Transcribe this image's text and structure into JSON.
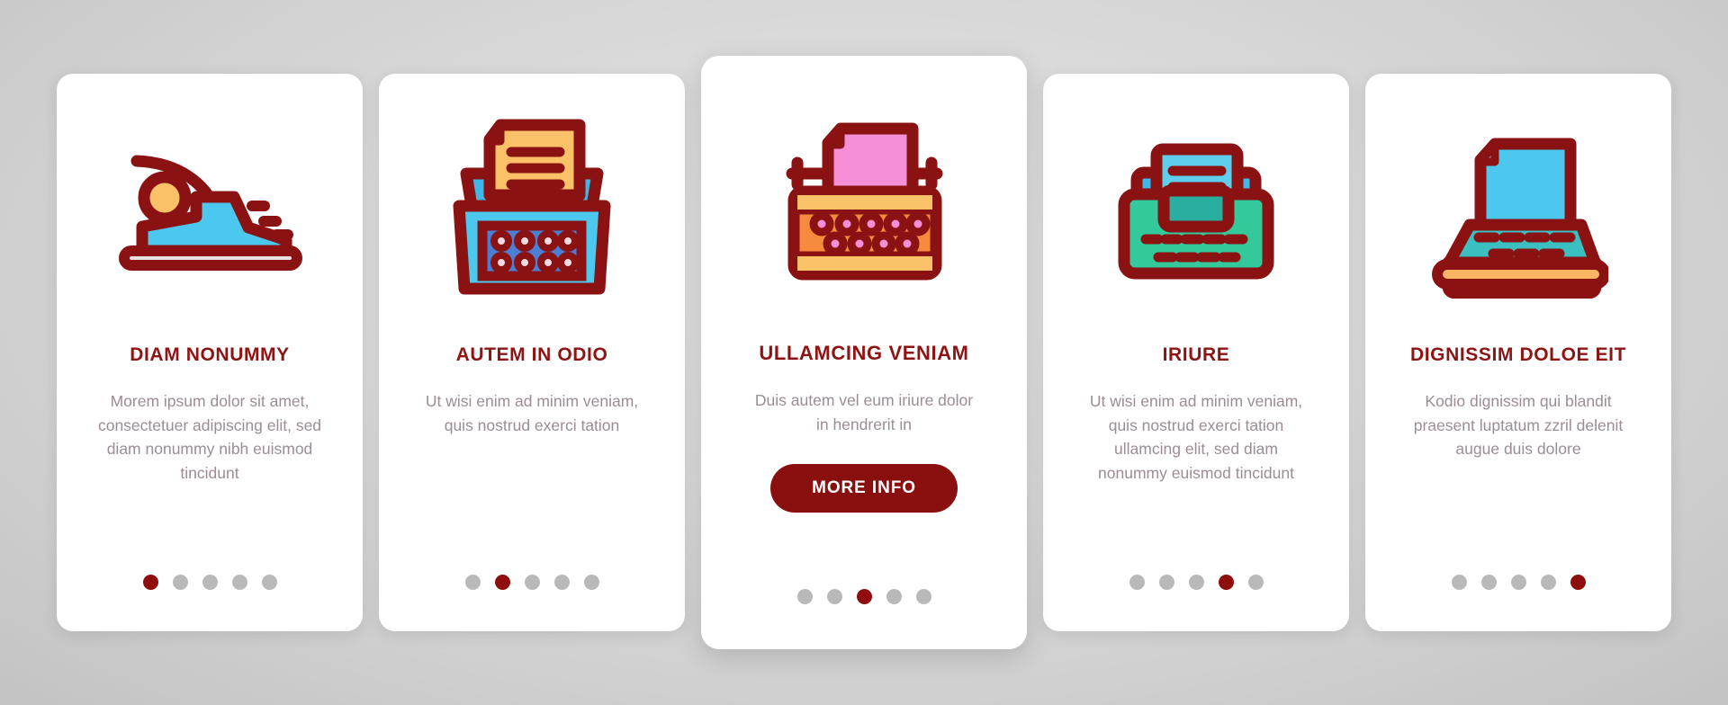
{
  "colors": {
    "accent_dark_red": "#8e1414",
    "button_bg": "#8a0f0f",
    "body_text": "#9c8c96",
    "dot_inactive": "#b9b9b9",
    "dot_active": "#8e0d0d",
    "card_bg": "#ffffff",
    "page_bg": "#d2d2d2",
    "icon_outline": "#8a1212",
    "cyan": "#4cc8ee",
    "yellow": "#f9c268",
    "blue_panel": "#4a7fd4",
    "pink": "#f78fd8",
    "orange": "#f58b3c",
    "orange_light": "#f9a95b",
    "green": "#34c99a",
    "teal": "#3bbfc0",
    "sky": "#3fb8e8"
  },
  "cards": [
    {
      "id": "card-1",
      "icon_name": "typewriter-carriage-icon",
      "title": "DIAM NONUMMY",
      "body": "Morem ipsum dolor sit amet, consectetuer adipiscing elit, sed diam nonummy nibh euismod tincidunt",
      "featured": false,
      "button_label": null,
      "dots": {
        "count": 5,
        "active_index": 0
      }
    },
    {
      "id": "card-2",
      "icon_name": "typewriter-paper-keys-icon",
      "title": "AUTEM IN ODIO",
      "body": "Ut wisi enim ad minim veniam, quis nostrud exerci tation",
      "featured": false,
      "button_label": null,
      "dots": {
        "count": 5,
        "active_index": 1
      }
    },
    {
      "id": "card-3",
      "icon_name": "typewriter-classic-icon",
      "title": "ULLAMCING VENIAM",
      "body": "Duis autem vel eum iriure dolor in hendrerit in",
      "featured": true,
      "button_label": "MORE INFO",
      "dots": {
        "count": 5,
        "active_index": 2
      }
    },
    {
      "id": "card-4",
      "icon_name": "typewriter-green-icon",
      "title": "IRIURE",
      "body": "Ut wisi enim ad minim veniam, quis nostrud exerci tation ullamcing elit, sed diam nonummy euismod tincidunt",
      "featured": false,
      "button_label": null,
      "dots": {
        "count": 5,
        "active_index": 3
      }
    },
    {
      "id": "card-5",
      "icon_name": "typewriter-desk-icon",
      "title": "DIGNISSIM DOLOE EIT",
      "body": "Kodio dignissim qui blandit praesent luptatum zzril delenit augue duis dolore",
      "featured": false,
      "button_label": null,
      "dots": {
        "count": 5,
        "active_index": 4
      }
    }
  ]
}
